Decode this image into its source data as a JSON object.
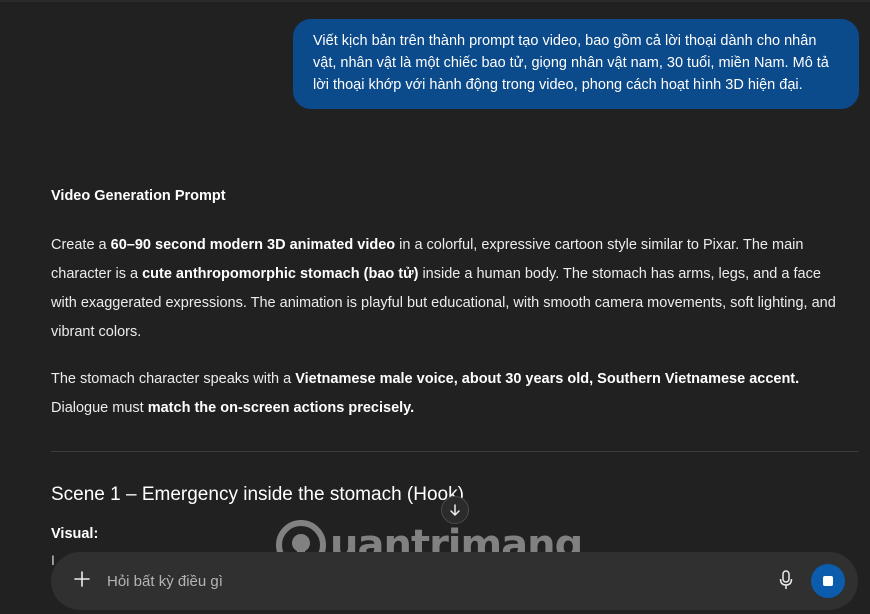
{
  "user_message": {
    "text": "Viết kịch bản trên thành prompt tạo video, bao gồm cả lời thoại dành cho nhân vật, nhân vật là một chiếc bao tử, giọng nhân vật nam, 30 tuổi, miền Nam. Mô tả lời thoại khớp với hành động trong video, phong cách hoạt hình 3D hiện đại."
  },
  "response": {
    "heading": "Video Generation Prompt",
    "p1": {
      "t1": "Create a ",
      "b1": "60–90 second modern 3D animated video",
      "t2": " in a colorful, expressive cartoon style similar to Pixar. The main character is a ",
      "b2": "cute anthropomorphic stomach (bao tử)",
      "t3": " inside a human body. The stomach has arms, legs, and a face with exaggerated expressions. The animation is playful but educational, with smooth camera movements, soft lighting, and vibrant colors."
    },
    "p2": {
      "t1": "The stomach character speaks with a ",
      "b1": "Vietnamese male voice, about 30 years old, Southern Vietnamese accent.",
      "t2": " Dialogue must ",
      "b2": "match the on-screen actions precisely."
    },
    "scene_title": "Scene 1 – Emergency inside the stomach (Hook)",
    "visual_label": "Visual:",
    "visual_text": "I"
  },
  "composer": {
    "placeholder": "Hỏi bất kỳ điều gì",
    "icons": {
      "plus": "plus-icon",
      "mic": "microphone-icon",
      "stop": "stop-icon"
    },
    "stop_color": "#0b5cad"
  },
  "scroll_down": {
    "icon": "arrow-down-icon"
  },
  "watermark": {
    "text": "uantrimang"
  },
  "colors": {
    "background": "#212121",
    "user_bubble": "#0b4a8b",
    "composer": "#303030"
  }
}
